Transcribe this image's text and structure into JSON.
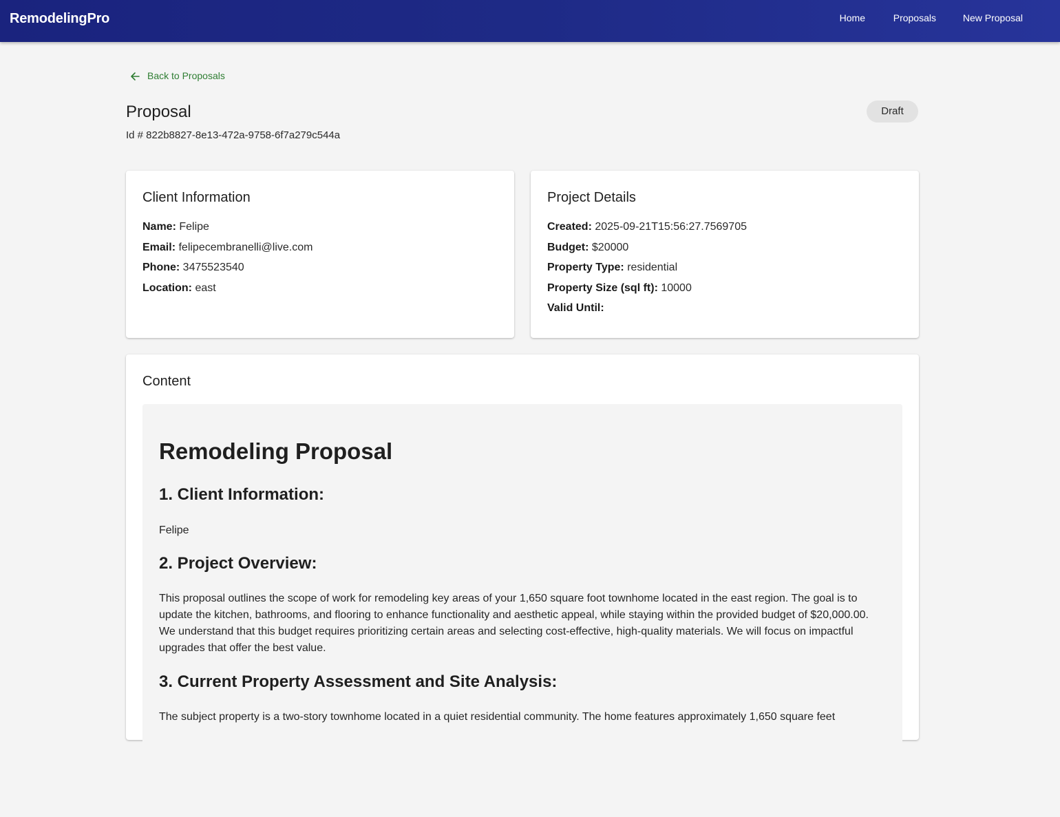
{
  "app": {
    "brand": "RemodelingPro",
    "nav": [
      {
        "label": "Home"
      },
      {
        "label": "Proposals"
      },
      {
        "label": "New Proposal"
      }
    ]
  },
  "header": {
    "back_label": "Back to Proposals",
    "title": "Proposal",
    "id_text": "Id # 822b8827-8e13-472a-9758-6f7a279c544a",
    "status": "Draft"
  },
  "client": {
    "title": "Client Information",
    "rows": [
      {
        "label": "Name:",
        "value": "Felipe"
      },
      {
        "label": "Email:",
        "value": "felipecembranelli@live.com"
      },
      {
        "label": "Phone:",
        "value": "3475523540"
      },
      {
        "label": "Location:",
        "value": "east"
      }
    ]
  },
  "project": {
    "title": "Project Details",
    "rows": [
      {
        "label": "Created:",
        "value": "2025-09-21T15:56:27.7569705"
      },
      {
        "label": "Budget:",
        "value": "$20000"
      },
      {
        "label": "Property Type:",
        "value": "residential"
      },
      {
        "label": "Property Size (sql ft):",
        "value": "10000"
      },
      {
        "label": "Valid Until:",
        "value": ""
      }
    ]
  },
  "content": {
    "title": "Content",
    "doc_title": "Remodeling Proposal",
    "section1_heading": "1. Client Information:",
    "section1_text": "Felipe",
    "section2_heading": "2. Project Overview:",
    "section2_text": "This proposal outlines the scope of work for remodeling key areas of your 1,650 square foot townhome located in the east region. The goal is to update the kitchen, bathrooms, and flooring to enhance functionality and aesthetic appeal, while staying within the provided budget of $20,000.00. We understand that this budget requires prioritizing certain areas and selecting cost-effective, high-quality materials. We will focus on impactful upgrades that offer the best value.",
    "section3_heading": "3. Current Property Assessment and Site Analysis:",
    "section3_text": "The subject property is a two-story townhome located in a quiet residential community. The home features approximately 1,650 square feet"
  },
  "colors": {
    "appbar": "#1a237e",
    "link_green": "#2e7d32",
    "page_bg": "#f4f4f4",
    "badge_bg": "#e2e2e2"
  },
  "icons": {
    "back": "arrow-left-icon"
  }
}
